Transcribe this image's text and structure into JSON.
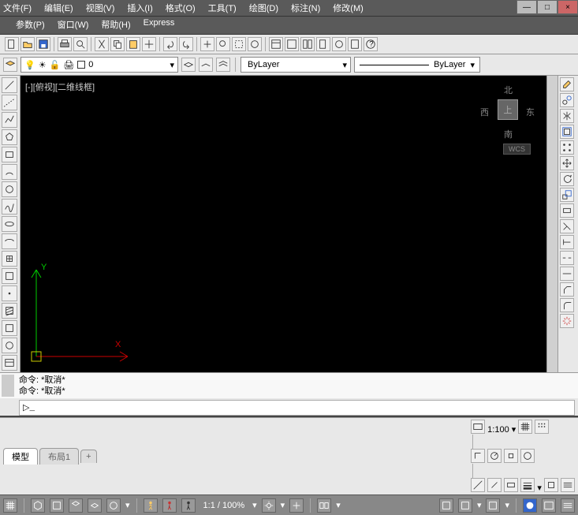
{
  "menu1": [
    "文件(F)",
    "编辑(E)",
    "视图(V)",
    "插入(I)",
    "格式(O)",
    "工具(T)",
    "绘图(D)",
    "标注(N)",
    "修改(M)"
  ],
  "menu2": [
    "参数(P)",
    "窗口(W)",
    "帮助(H)",
    "Express"
  ],
  "layer": {
    "value": "0"
  },
  "color_sel": "ByLayer",
  "lineweight_sel": "ByLayer",
  "viewport_label": "[-][俯视][二维线框]",
  "compass": {
    "n": "北",
    "s": "南",
    "e": "东",
    "w": "西",
    "face": "上"
  },
  "wcs": "WCS",
  "cmd": {
    "hist1": "命令: *取消*",
    "hist2": "命令: *取消*",
    "prompt": "▷_",
    "value": ""
  },
  "tabs": {
    "model": "模型",
    "layout1": "布局1",
    "plus": "+"
  },
  "status": {
    "scale_label": "1:100"
  },
  "bottom": {
    "zoom": "1:1 / 100%"
  },
  "winbtns": {
    "min": "—",
    "max": "□",
    "close": "×"
  },
  "ucs": {
    "x": "X",
    "y": "Y"
  }
}
